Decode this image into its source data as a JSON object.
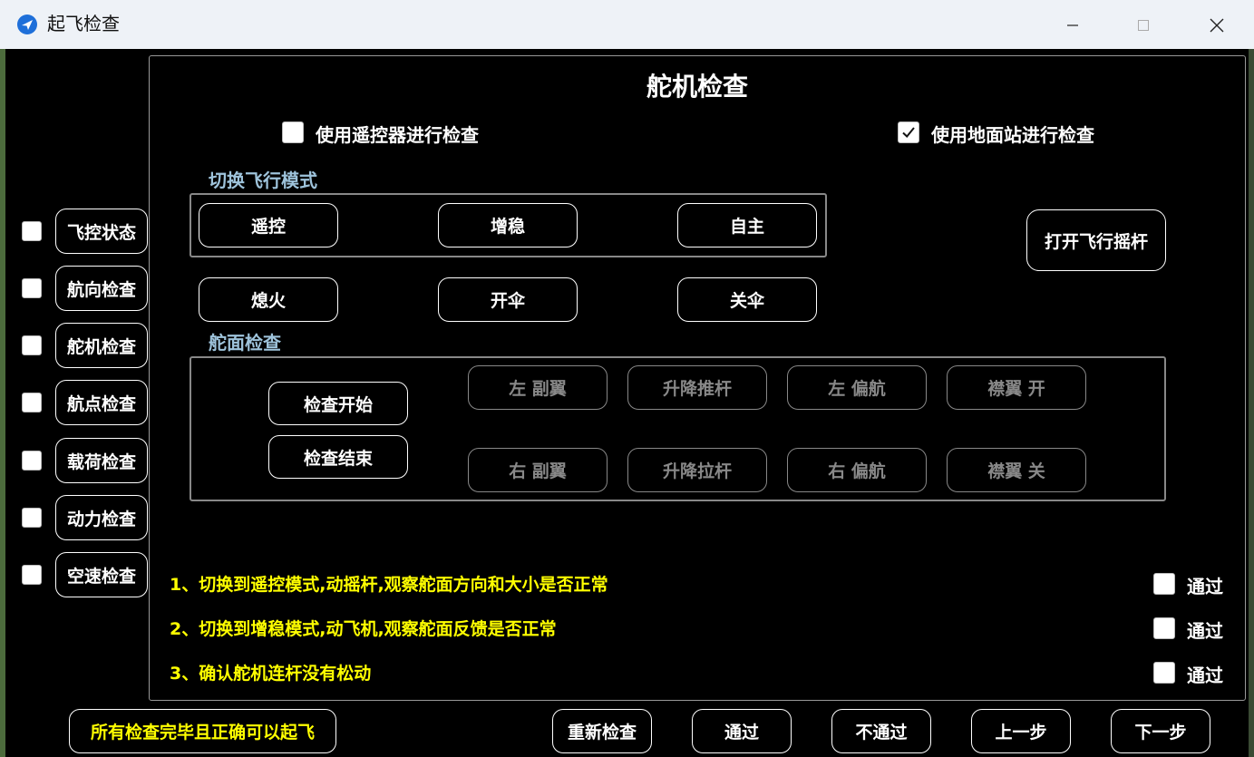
{
  "window": {
    "title": "起飞检查"
  },
  "sidebar": {
    "items": [
      {
        "label": "飞控状态",
        "checked": false
      },
      {
        "label": "航向检查",
        "checked": false
      },
      {
        "label": "舵机检查",
        "checked": false
      },
      {
        "label": "航点检查",
        "checked": false
      },
      {
        "label": "载荷检查",
        "checked": false
      },
      {
        "label": "动力检查",
        "checked": false
      },
      {
        "label": "空速检查",
        "checked": false
      }
    ]
  },
  "main": {
    "title": "舵机检查",
    "options": {
      "remote": {
        "label": "使用遥控器进行检查",
        "checked": false
      },
      "ground": {
        "label": "使用地面站进行检查",
        "checked": true
      }
    },
    "mode_section": {
      "title": "切换飞行模式",
      "buttons": [
        "遥控",
        "增稳",
        "自主"
      ],
      "open_stick": "打开飞行摇杆"
    },
    "actions": [
      "熄火",
      "开伞",
      "关伞"
    ],
    "surface_section": {
      "title": "舵面检查",
      "start": "检查开始",
      "end": "检查结束",
      "row1": [
        "左 副翼",
        "升降推杆",
        "左 偏航",
        "襟翼 开"
      ],
      "row2": [
        "右 副翼",
        "升降拉杆",
        "右 偏航",
        "襟翼 关"
      ]
    },
    "steps": [
      {
        "text": "1、切换到遥控模式,动摇杆,观察舵面方向和大小是否正常",
        "pass_label": "通过",
        "checked": false
      },
      {
        "text": "2、切换到增稳模式,动飞机,观察舵面反馈是否正常",
        "pass_label": "通过",
        "checked": false
      },
      {
        "text": "3、确认舵机连杆没有松动",
        "pass_label": "通过",
        "checked": false
      }
    ]
  },
  "footer": {
    "all_ok": "所有检查完毕且正确可以起飞",
    "recheck": "重新检查",
    "pass": "通过",
    "fail": "不通过",
    "prev": "上一步",
    "next": "下一步"
  },
  "colors": {
    "section_title": "#9ec3db",
    "step_text": "#ffff00",
    "frame_border": "#888888",
    "disabled": "#888888"
  },
  "icons": {
    "app": "paper-plane-icon",
    "minimize": "minimize-icon",
    "maximize": "maximize-icon",
    "close": "close-icon",
    "check": "checkmark-icon"
  }
}
